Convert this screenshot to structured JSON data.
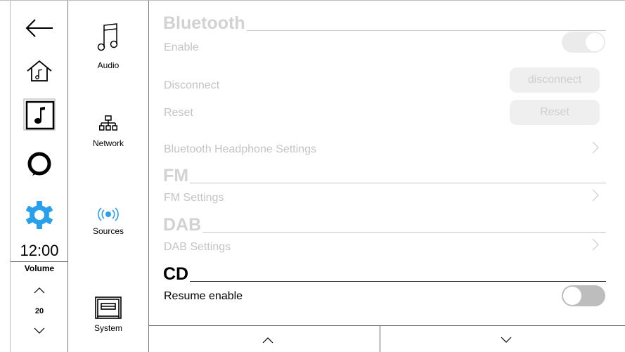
{
  "rail": {
    "back_icon": "arrow-left-icon",
    "home_icon": "home-music-icon",
    "now_playing_icon": "music-note-icon",
    "alexa_icon": "alexa-ring-icon",
    "settings_icon": "gear-icon",
    "settings_color": "#2aa0ea",
    "clock": "12:00",
    "volume_label": "Volume",
    "volume_value": "20"
  },
  "categories": {
    "audio": "Audio",
    "network": "Network",
    "sources": "Sources",
    "system": "System",
    "sources_color": "#2aa0ea"
  },
  "bluetooth": {
    "title": "Bluetooth",
    "enable": "Enable",
    "disconnect": "Disconnect",
    "disconnect_btn": "disconnect",
    "reset": "Reset",
    "reset_btn": "Reset",
    "headphone": "Bluetooth Headphone Settings"
  },
  "fm": {
    "title": "FM",
    "settings": "FM Settings"
  },
  "dab": {
    "title": "DAB",
    "settings": "DAB Settings"
  },
  "cd": {
    "title": "CD",
    "resume": "Resume enable"
  }
}
